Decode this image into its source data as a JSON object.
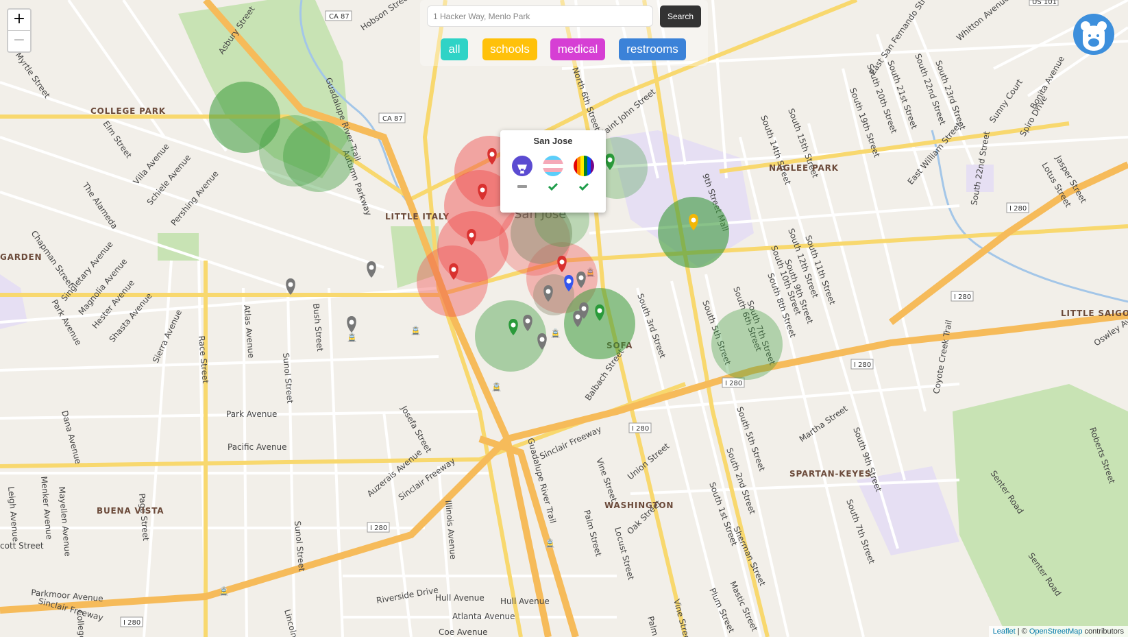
{
  "zoom": {
    "in_label": "+",
    "out_label": "−"
  },
  "search": {
    "placeholder": "1 Hacker Way, Menlo Park",
    "button_label": "Search"
  },
  "filters": [
    {
      "label": "all",
      "color": "#2fd3c6"
    },
    {
      "label": "schools",
      "color": "#ffc10a"
    },
    {
      "label": "medical",
      "color": "#d63fd4"
    },
    {
      "label": "restrooms",
      "color": "#3b82d8"
    }
  ],
  "popup": {
    "title": "San Jose",
    "icons": [
      "restroom-icon",
      "transgender-flag-icon",
      "pride-flag-icon"
    ],
    "statuses": [
      "dash",
      "check",
      "check"
    ]
  },
  "attribution": {
    "leaflet": "Leaflet",
    "separator": " | © ",
    "osm": "OpenStreetMap",
    "suffix": " contributors"
  },
  "map_labels": {
    "areas": [
      "COLLEGE PARK",
      "LITTLE ITALY",
      "NAGLEE PARK",
      "GARDEN",
      "LITTLE SAIGON",
      "SOFA",
      "SPARTAN-KEYES",
      "WASHINGTON",
      "BUENA VISTA"
    ],
    "city": "San Jose",
    "streets": [
      "Asbury Street",
      "Hobson Street",
      "Myrtle Street",
      "Elm Street",
      "Villa Avenue",
      "Schiele Avenue",
      "Pershing Avenue",
      "The Alameda",
      "Chapman Street",
      "Singletary Avenue",
      "Magnolia Avenue",
      "Hester Avenue",
      "Shasta Avenue",
      "Park Avenue",
      "Sierra Avenue",
      "Race Street",
      "Atlas Avenue",
      "Bush Street",
      "Sunol Street",
      "Pacific Avenue",
      "Josefa Street",
      "Auzerais Avenue",
      "Sinclair Freeway",
      "Guadalupe River Trail",
      "Autumn Parkway",
      "North 6th Street",
      "Saint John Street",
      "South 3rd Street",
      "South 5th Street",
      "South 6th Street",
      "South 7th Street",
      "South 8th Street",
      "South 9th Street",
      "South 10th Street",
      "South 11th Street",
      "South 12th Street",
      "South 14th Street",
      "South 15th Street",
      "South 19th Street",
      "South 20th Street",
      "South 21st Street",
      "South 22nd Street",
      "South 23rd Street",
      "East San Fernando Street",
      "Whitton Avenue",
      "East William Street",
      "Coyote Creek Trail",
      "Sunny Court",
      "Bonita Avenue",
      "Spiro Drive",
      "Jasper Street",
      "Lotus Street",
      "Oswley Av",
      "Roberts Street",
      "Senter Road",
      "Martha Street",
      "Balbach Street",
      "Union Street",
      "Vine Street",
      "Palm Street",
      "Locust Street",
      "Oak Street",
      "Sherman Street",
      "Mastic Street",
      "Plum Street",
      "South 1st Street",
      "South 2nd Street",
      "South 3rd Street",
      "Illinois Avenue",
      "Riverside Drive",
      "Hull Avenue",
      "Atlanta Avenue",
      "Coe Avenue",
      "Parkmoor Avenue",
      "Menker Avenue",
      "Mayellen Avenue",
      "Page Street",
      "Leigh Avenue",
      "Dana Avenue",
      "9th Street Mall",
      "Lincoln",
      "College"
    ],
    "shields": [
      "CA 87",
      "CA 87",
      "I 280",
      "I 280",
      "I 280",
      "I 280",
      "I 280",
      "I 280",
      "I 280",
      "I 280",
      "US 101"
    ]
  },
  "colors": {
    "red_circle": "#f04a4a",
    "green_circle": "#3a9a3a",
    "gray_marker": "#777777",
    "red_marker": "#d9312f",
    "green_marker": "#2a9a3a",
    "yellow_marker": "#f2b705",
    "blue_marker": "#3355ee",
    "freeway": "#f6bb5a",
    "major_road": "#f8d86e",
    "water": "#a3c6e8",
    "park": "#c8e3b4",
    "school": "#e6dff3"
  }
}
